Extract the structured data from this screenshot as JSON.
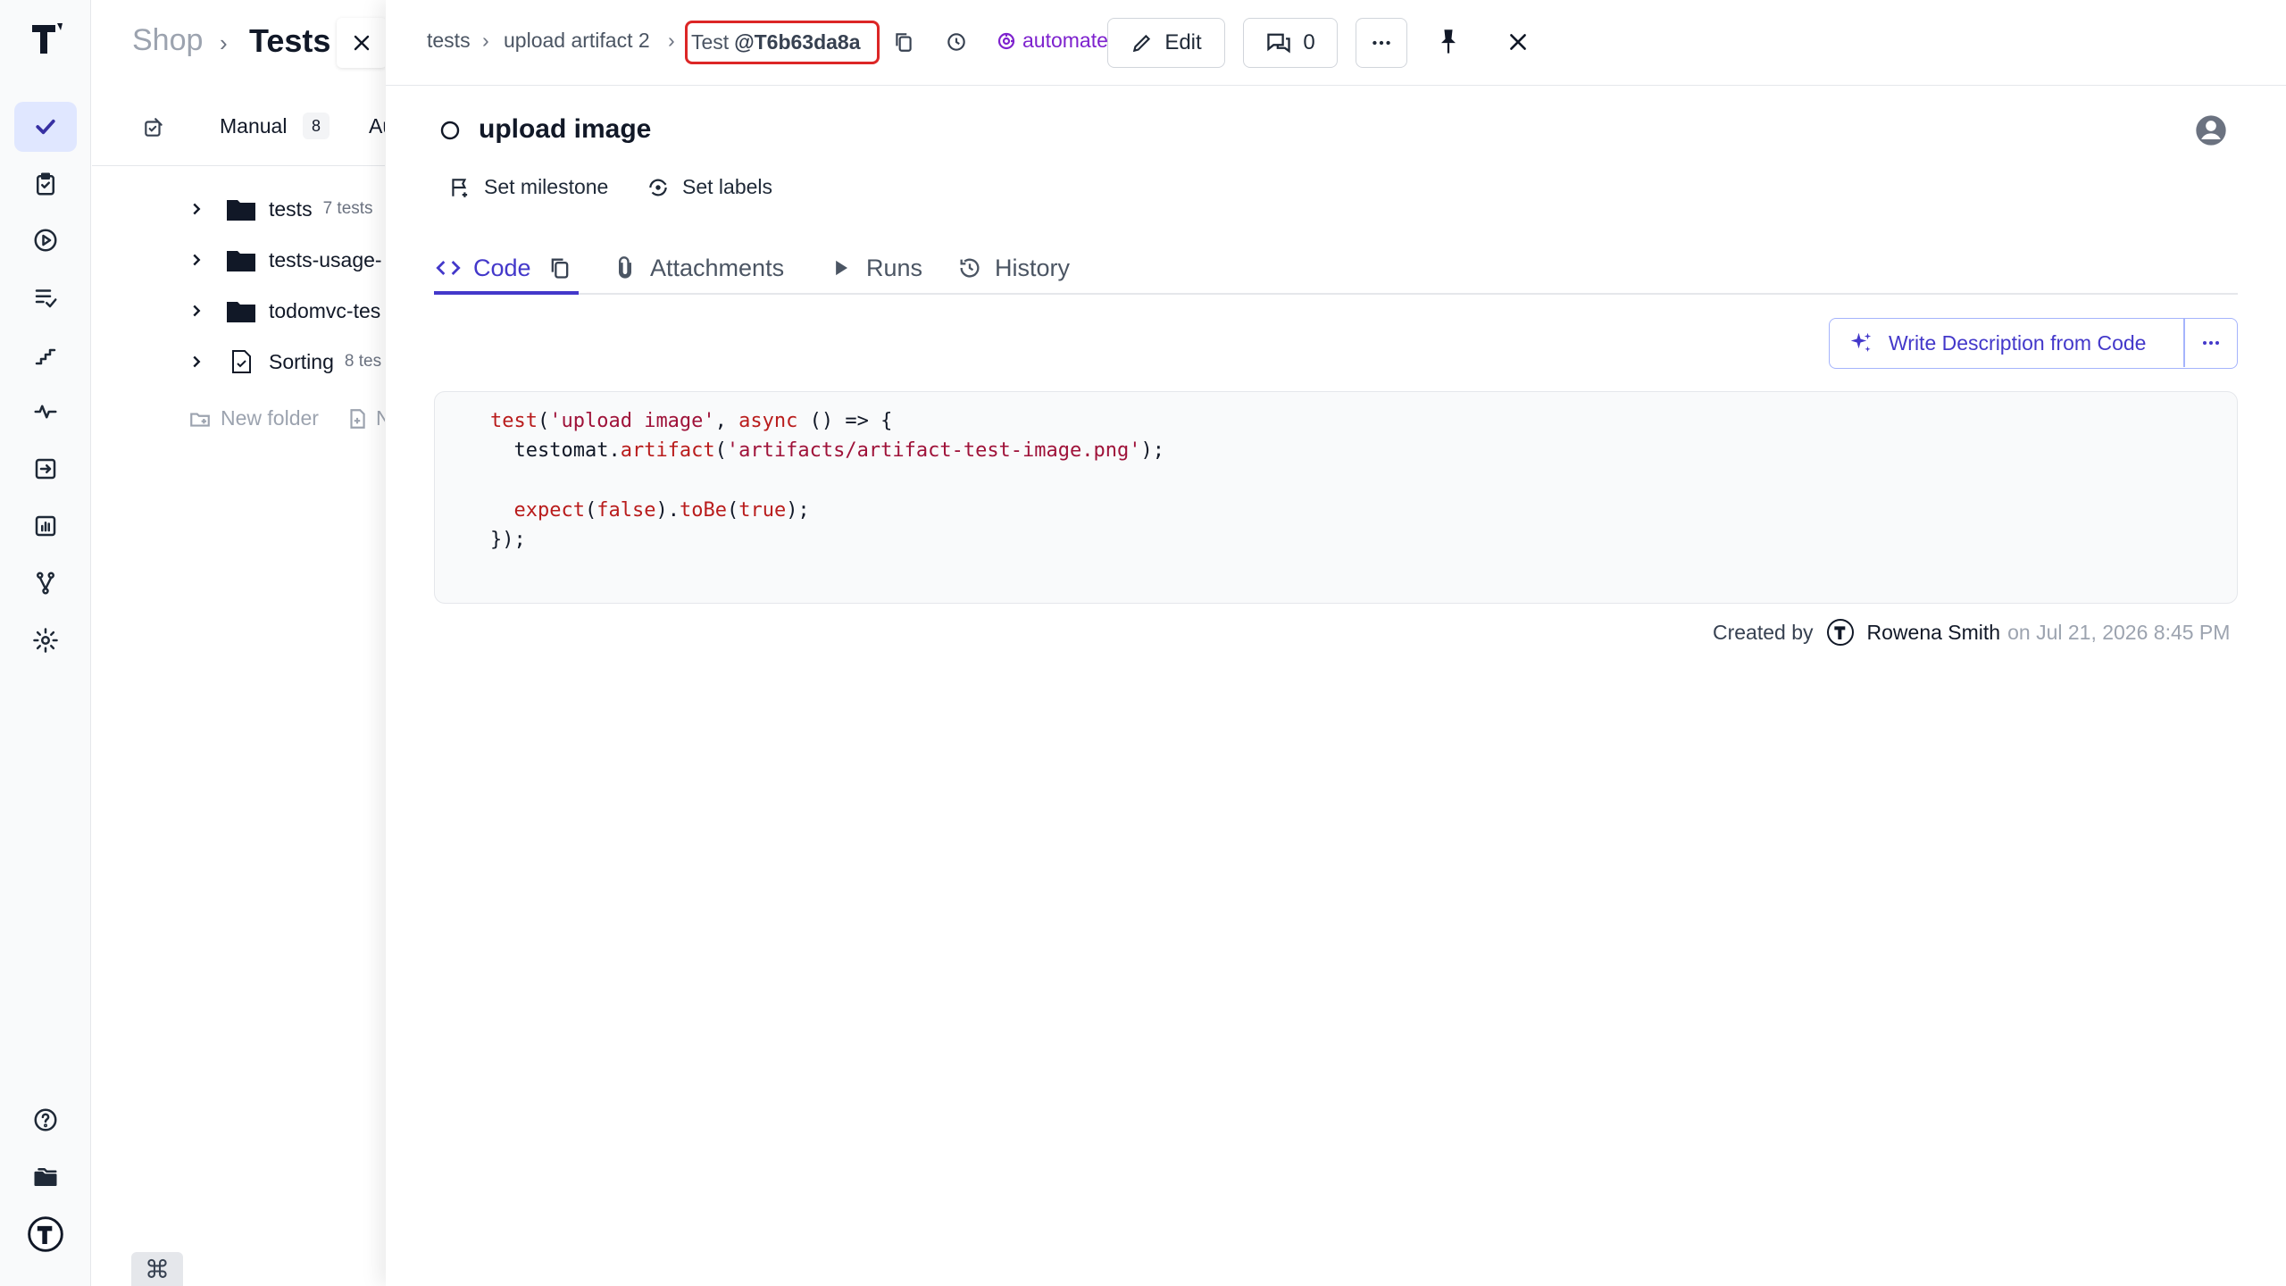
{
  "app": {
    "logo": "T"
  },
  "rail": {
    "items": [
      {
        "icon": "check-icon",
        "active": true
      },
      {
        "icon": "clipboard-check-icon"
      },
      {
        "icon": "play-circle-icon"
      },
      {
        "icon": "list-check-icon"
      },
      {
        "icon": "steps-icon"
      },
      {
        "icon": "pulse-icon"
      },
      {
        "icon": "import-icon"
      },
      {
        "icon": "bar-chart-icon"
      },
      {
        "icon": "branch-icon"
      },
      {
        "icon": "gear-icon"
      }
    ],
    "bottom": [
      {
        "icon": "help-icon"
      },
      {
        "icon": "folders-icon"
      },
      {
        "icon": "testomat-logo-icon"
      }
    ]
  },
  "left_panel": {
    "breadcrumb": {
      "project": "Shop",
      "section": "Tests"
    },
    "tabs": [
      {
        "label": "Manual",
        "count": "8"
      },
      {
        "label": "Au"
      }
    ],
    "tree": [
      {
        "name": "tests",
        "count": "7 tests",
        "type": "folder"
      },
      {
        "name": "tests-usage-",
        "type": "folder"
      },
      {
        "name": "todomvc-tes",
        "type": "folder"
      },
      {
        "name": "Sorting",
        "count": "8 tes",
        "type": "suite"
      }
    ],
    "actions": {
      "new_folder": "New folder",
      "new_suite": "N"
    },
    "kbd": "⌘"
  },
  "drawer": {
    "breadcrumb": [
      "tests",
      "upload artifact 2"
    ],
    "test_id_prefix": "Test",
    "test_id": "@T6b63da8a",
    "status_badge": "automated",
    "edit_label": "Edit",
    "comments_count": "0",
    "title": "upload image",
    "set_milestone": "Set milestone",
    "set_labels": "Set labels",
    "tabs": [
      {
        "label": "Code",
        "active": true
      },
      {
        "label": "Attachments"
      },
      {
        "label": "Runs"
      },
      {
        "label": "History"
      }
    ],
    "write_description": "Write Description from Code",
    "code": [
      "test('upload image', async () => {",
      "  testomat.artifact('artifacts/artifact-test-image.png');",
      "",
      "  expect(false).toBe(true);",
      "});"
    ],
    "created_by_label": "Created by",
    "author": "Rowena Smith",
    "created_on": "on Jul 21, 2026 8:45 PM"
  },
  "colors": {
    "accent": "#4338ca",
    "automated": "#7e22ce",
    "highlight": "#dc2626",
    "active_rail": "#e0e7ff"
  }
}
